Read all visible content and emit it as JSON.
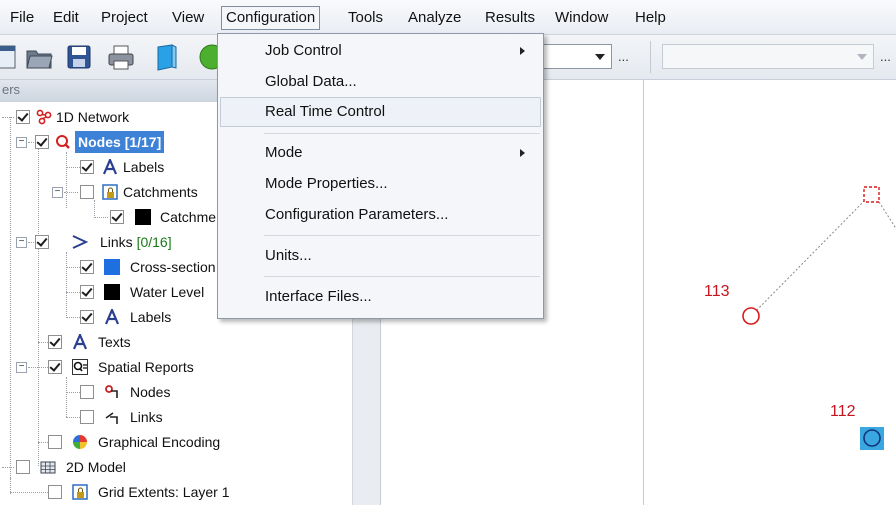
{
  "menubar": {
    "items": [
      "File",
      "Edit",
      "Project",
      "View",
      "Configuration",
      "Tools",
      "Analyze",
      "Results",
      "Window",
      "Help"
    ]
  },
  "toolbar": {
    "ellipsis_1": "...",
    "ellipsis_2": "..."
  },
  "config_menu": {
    "items": [
      "Job Control",
      "Global Data...",
      "Real Time Control",
      "Mode",
      "Mode Properties...",
      "Configuration Parameters...",
      "Units...",
      "Interface Files..."
    ],
    "highlighted": "Real Time Control"
  },
  "layers_panel": {
    "header": "ers",
    "tree": [
      {
        "label": "1D Network",
        "checked": true,
        "icon": "network-icon"
      },
      {
        "label": "Nodes",
        "count": "[1/17]",
        "checked": true,
        "selected": true,
        "icon": "node-query-icon"
      },
      {
        "label": "Labels",
        "checked": true,
        "icon": "label-icon"
      },
      {
        "label": "Catchments",
        "checked": false,
        "icon": "locked-layer-icon"
      },
      {
        "label": "Catchme",
        "checked": true,
        "icon": "black-swatch-icon"
      },
      {
        "label": "Links",
        "count": "[0/16]",
        "checked": true,
        "icon": "link-icon"
      },
      {
        "label": "Cross-section",
        "checked": true,
        "icon": "blue-swatch-icon"
      },
      {
        "label": "Water Level",
        "checked": true,
        "icon": "black-swatch-icon"
      },
      {
        "label": "Labels",
        "checked": true,
        "icon": "label-icon"
      },
      {
        "label": "Texts",
        "checked": true,
        "icon": "label-icon"
      },
      {
        "label": "Spatial Reports",
        "checked": true,
        "icon": "spatial-report-icon"
      },
      {
        "label": "Nodes",
        "checked": false,
        "icon": "node-report-icon"
      },
      {
        "label": "Links",
        "checked": false,
        "icon": "link-report-icon"
      },
      {
        "label": "Graphical Encoding",
        "checked": false,
        "icon": "color-wheel-icon"
      },
      {
        "label": "2D Model",
        "checked": false,
        "icon": "model-2d-icon"
      },
      {
        "label": "Grid Extents: Layer 1",
        "checked": false,
        "icon": "locked-layer-icon"
      }
    ]
  },
  "map": {
    "node_labels": [
      "113",
      "112"
    ],
    "label_color": "#c8141e",
    "node_color": "#d81b1b",
    "selected_fill": "#3aa7e0"
  }
}
